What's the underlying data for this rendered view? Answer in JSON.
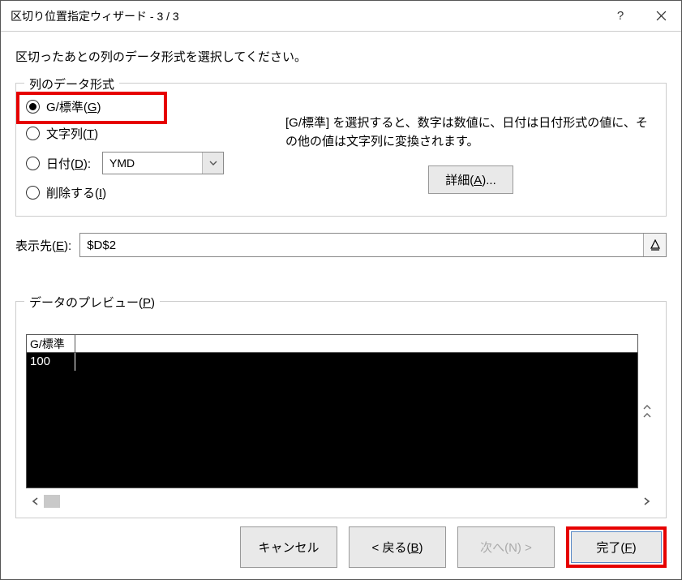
{
  "title": "区切り位置指定ウィザード - 3 / 3",
  "intro": "区切ったあとの列のデータ形式を選択してください。",
  "format": {
    "legend": "列のデータ形式",
    "general_label": "G/標準(G)",
    "text_label": "文字列(T)",
    "date_label": "日付(D):",
    "date_value": "YMD",
    "skip_label": "削除する(I)",
    "desc": "[G/標準] を選択すると、数字は数値に、日付は日付形式の値に、その他の値は文字列に変換されます。",
    "detail_button": "詳細(A)..."
  },
  "destination": {
    "label": "表示先(E):",
    "value": "$D$2"
  },
  "preview": {
    "legend": "データのプレビュー(P)",
    "header_cell": "G/標準",
    "row1": "100"
  },
  "footer": {
    "cancel": "キャンセル",
    "back": "< 戻る(B)",
    "next": "次へ(N) >",
    "finish": "完了(F)"
  }
}
